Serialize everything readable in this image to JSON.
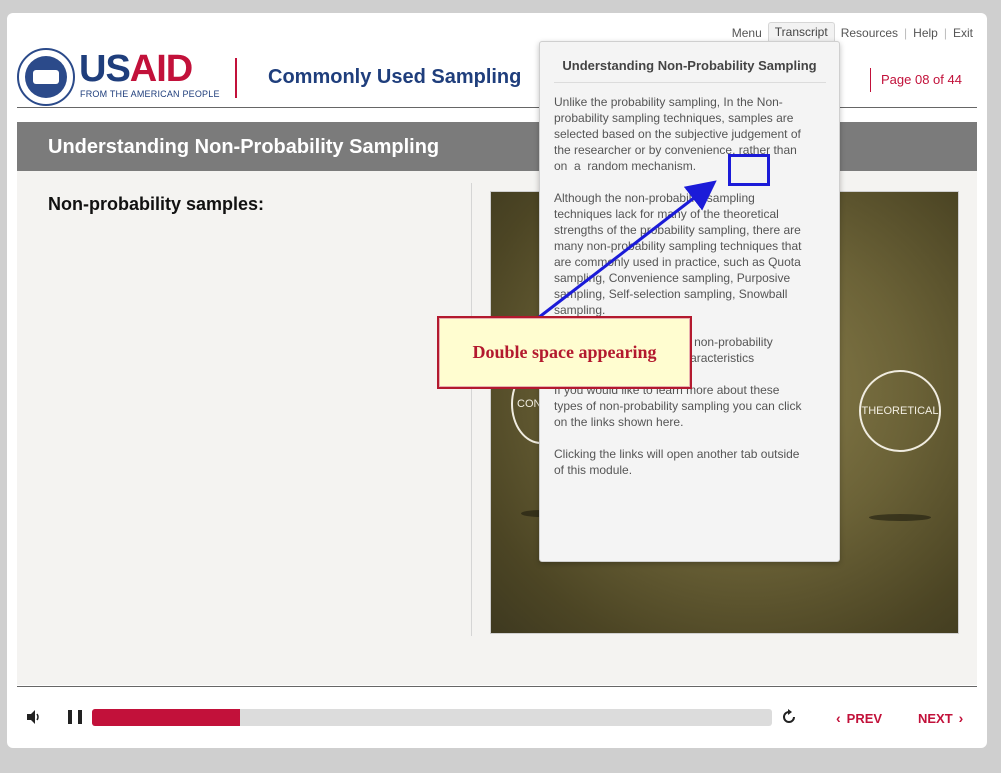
{
  "topnav": {
    "items": [
      "Menu",
      "Transcript",
      "Resources",
      "Help",
      "Exit"
    ]
  },
  "header": {
    "logo_usa": "US",
    "logo_aid": "AID",
    "logo_tagline": "FROM THE AMERICAN PEOPLE",
    "course_title": "Commonly Used Sampling",
    "page_counter": "Page 08 of  44"
  },
  "section": {
    "title": "Understanding Non-Probability Sampling",
    "subhead": "Non-probability samples:"
  },
  "image_panel": {
    "labels": [
      "CONV",
      "THEORETICAL"
    ]
  },
  "transcript": {
    "title": "Understanding Non-Probability Sampling",
    "paragraphs": [
      "Unlike the probability sampling, In the Non-probability sampling techniques, samples are selected based on the subjective judgement of the researcher or by convenience, rather than on  a  random mechanism.",
      "Although the non-probability sampling techniques lack for many of the theoretical strengths of the probability sampling, there are many non-probability sampling techniques that are commonly used in practice, such as Quota sampling, Convenience sampling, Purposive sampling, Self-selection sampling, Snowball sampling.",
      "Let us look at the types of non-probability sampling and their key characteristics",
      "If you would like to learn more about these types of non-probability sampling you can click on the links shown here.",
      "Clicking the links will open another tab outside of this module."
    ]
  },
  "annotation": {
    "callout_text": "Double space appearing",
    "color": "#1b1bd8"
  },
  "controls": {
    "progress_fraction": 0.218,
    "prev_label": "PREV",
    "next_label": "NEXT",
    "accent": "#c2113a"
  }
}
